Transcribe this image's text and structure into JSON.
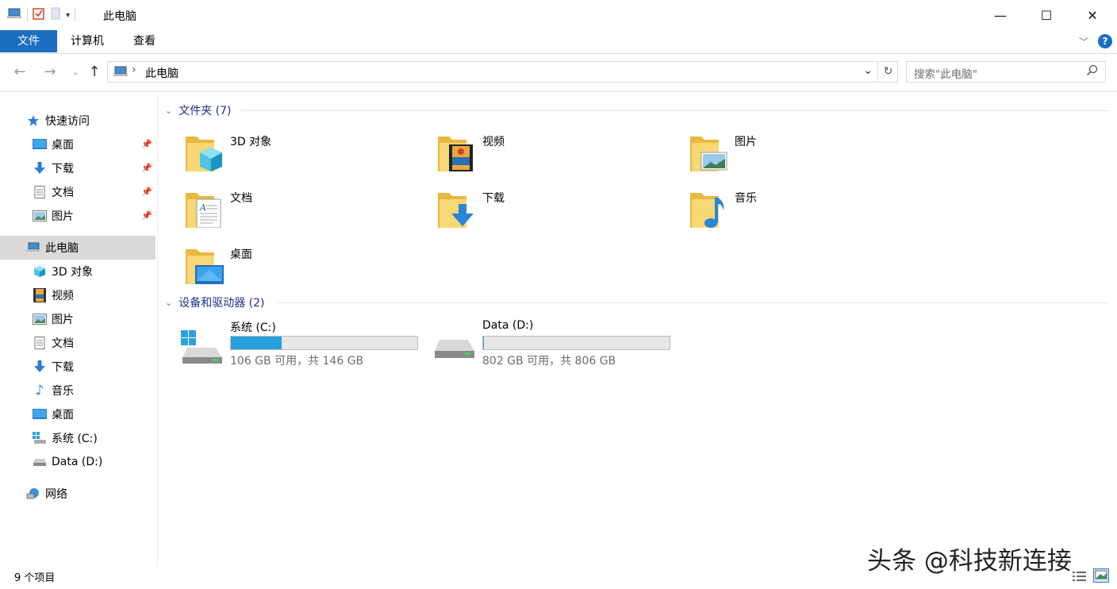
{
  "window": {
    "title": "此电脑",
    "controls": {
      "minimize": "—",
      "maximize": "☐",
      "close": "✕"
    }
  },
  "ribbon": {
    "tabs": [
      "文件",
      "计算机",
      "查看"
    ],
    "help": "?"
  },
  "navigation": {
    "address": "此电脑",
    "search_placeholder": "搜索\"此电脑\""
  },
  "sidebar": {
    "quick_access": {
      "label": "快速访问",
      "items": [
        "桌面",
        "下载",
        "文档",
        "图片"
      ]
    },
    "this_pc": {
      "label": "此电脑",
      "items": [
        "3D 对象",
        "视频",
        "图片",
        "文档",
        "下载",
        "音乐",
        "桌面",
        "系统 (C:)",
        "Data (D:)"
      ]
    },
    "network": {
      "label": "网络"
    }
  },
  "main": {
    "folders_header": "文件夹 (7)",
    "folders": [
      {
        "name": "3D 对象",
        "icon": "3d-objects-icon"
      },
      {
        "name": "视频",
        "icon": "videos-icon"
      },
      {
        "name": "图片",
        "icon": "pictures-icon"
      },
      {
        "name": "文档",
        "icon": "documents-icon"
      },
      {
        "name": "下载",
        "icon": "downloads-icon"
      },
      {
        "name": "音乐",
        "icon": "music-icon"
      },
      {
        "name": "桌面",
        "icon": "desktop-icon"
      }
    ],
    "drives_header": "设备和驱动器 (2)",
    "drives": [
      {
        "name": "系统 (C:)",
        "info": "106 GB 可用，共 146 GB",
        "used_fraction": 0.274
      },
      {
        "name": "Data (D:)",
        "info": "802 GB 可用，共 806 GB",
        "used_fraction": 0.005
      }
    ]
  },
  "status": {
    "count": "9 个项目"
  },
  "watermark": "头条 @科技新连接",
  "colors": {
    "accent": "#1a6fc0",
    "drive_fill": "#26a0da",
    "group_header": "#1e3287",
    "folder": "#f5c94d"
  }
}
